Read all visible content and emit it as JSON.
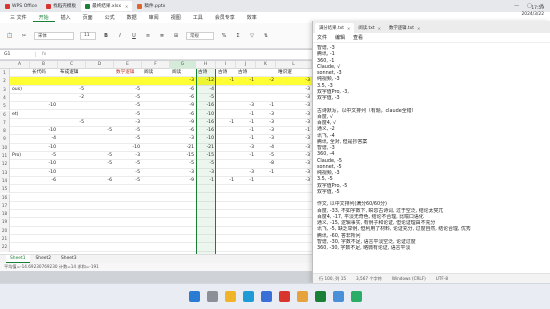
{
  "titlebar": {
    "tabs": [
      {
        "label": "WPS Office",
        "color": "#d9352f",
        "active": false
      },
      {
        "label": "找稻壳模板",
        "color": "#d9352f",
        "active": false
      },
      {
        "label": "最终结果.xlsx",
        "color": "#1a7f37",
        "active": true
      },
      {
        "label": "稿件.pptx",
        "color": "#e0642a",
        "active": false
      }
    ]
  },
  "menubar": {
    "items": [
      "三 文件",
      "开始",
      "插入",
      "页面",
      "公式",
      "数据",
      "审阅",
      "视图",
      "工具",
      "会员专享",
      "效率"
    ],
    "selected": "开始"
  },
  "ribbon": {
    "font_name": "宋体",
    "font_size": "11",
    "number_format": "常规"
  },
  "formula_bar": {
    "cell_ref": "G1",
    "fx": "fx"
  },
  "sheet": {
    "columns": [
      "A",
      "B",
      "C",
      "D",
      "E",
      "F",
      "G",
      "H",
      "I",
      "J",
      "K",
      "L"
    ],
    "selected_column": "G",
    "rows": [
      {
        "n": "1",
        "cells": [
          "",
          "长代码",
          "布成逻辑",
          "",
          "数学逻辑",
          "阅读",
          "阅读",
          "古诗",
          "古诗",
          "古诗",
          "",
          "唯识逻"
        ]
      },
      {
        "n": "2",
        "cells": [
          "",
          "",
          "",
          "",
          "",
          "",
          "-3",
          "-12",
          "-1",
          "-1",
          "-2",
          "-3"
        ]
      },
      {
        "n": "3",
        "cells": [
          "ous)",
          "",
          "-5",
          "",
          "-5",
          "",
          "-6",
          "-4",
          "",
          "",
          "",
          "-3"
        ]
      },
      {
        "n": "4",
        "cells": [
          "",
          "",
          "-2",
          "",
          "-5",
          "",
          "-6",
          "-5",
          "",
          "",
          "",
          "-3"
        ]
      },
      {
        "n": "5",
        "cells": [
          "",
          "-10",
          "",
          "",
          "-5",
          "",
          "-9",
          "-16",
          "",
          "-3",
          "-1",
          "-3"
        ]
      },
      {
        "n": "6",
        "cells": [
          "et)",
          "",
          "",
          "",
          "-5",
          "",
          "-6",
          "-10",
          "",
          "-1",
          "-3",
          "-3"
        ]
      },
      {
        "n": "7",
        "cells": [
          "",
          "",
          "-5",
          "",
          "-3",
          "",
          "-9",
          "-16",
          "-1",
          "-1",
          "-3",
          "-3"
        ]
      },
      {
        "n": "8",
        "cells": [
          "",
          "-10",
          "",
          "-5",
          "-5",
          "",
          "-6",
          "-16",
          "",
          "-1",
          "-3",
          "-1"
        ]
      },
      {
        "n": "9",
        "cells": [
          "",
          "-4",
          "",
          "",
          "-5",
          "",
          "-3",
          "-10",
          "",
          "-1",
          "-3",
          "-3"
        ]
      },
      {
        "n": "10",
        "cells": [
          "",
          "-10",
          "",
          "",
          "-10",
          "",
          "-21",
          "-21",
          "",
          "-3",
          "-4",
          "-3"
        ]
      },
      {
        "n": "11",
        "cells": [
          "Pro)",
          "-5",
          "",
          "-5",
          "-3",
          "",
          "-15",
          "-15",
          "",
          "-1",
          "-5",
          "-3"
        ]
      },
      {
        "n": "12",
        "cells": [
          "",
          "-10",
          "",
          "-5",
          "-5",
          "",
          "-5",
          "-5",
          "",
          "",
          "-8",
          "-3"
        ]
      },
      {
        "n": "13",
        "cells": [
          "",
          "-10",
          "",
          "",
          "-5",
          "",
          "-3",
          "-3",
          "",
          "-3",
          "-1",
          "-3"
        ]
      },
      {
        "n": "14",
        "cells": [
          "",
          "-6",
          "",
          "-6",
          "-5",
          "",
          "-9",
          "-1",
          "-1",
          "-1",
          "",
          "-3"
        ]
      },
      {
        "n": "15",
        "cells": [
          "",
          "",
          "",
          "",
          "",
          "",
          "",
          "",
          "",
          "",
          "",
          ""
        ]
      },
      {
        "n": "16",
        "cells": [
          "",
          "",
          "",
          "",
          "",
          "",
          "",
          "",
          "",
          "",
          "",
          ""
        ]
      },
      {
        "n": "17",
        "cells": [
          "",
          "",
          "",
          "",
          "",
          "",
          "",
          "",
          "",
          "",
          "",
          ""
        ]
      },
      {
        "n": "18",
        "cells": [
          "",
          "",
          "",
          "",
          "",
          "",
          "",
          "",
          "",
          "",
          "",
          ""
        ]
      },
      {
        "n": "19",
        "cells": [
          "",
          "",
          "",
          "",
          "",
          "",
          "",
          "",
          "",
          "",
          "",
          ""
        ]
      },
      {
        "n": "20",
        "cells": [
          "",
          "",
          "",
          "",
          "",
          "",
          "",
          "",
          "",
          "",
          "",
          ""
        ]
      },
      {
        "n": "21",
        "cells": [
          "",
          "",
          "",
          "",
          "",
          "",
          "",
          "",
          "",
          "",
          "",
          ""
        ]
      },
      {
        "n": "22",
        "cells": [
          "",
          "",
          "",
          "",
          "",
          "",
          "",
          "",
          "",
          "",
          "",
          ""
        ]
      }
    ],
    "highlight_row": "2"
  },
  "sheet_tabs": [
    "Sheet1",
    "Sheet2",
    "Sheet3"
  ],
  "active_sheet": "Sheet1",
  "statusbar": "平均值=-14.69230769230 计数=14 求和=-191",
  "notepad": {
    "tabs": [
      {
        "label": "满分结果.txt",
        "active": true
      },
      {
        "label": "阅读.txt",
        "active": false
      },
      {
        "label": "数学逻辑.txt",
        "active": false
      }
    ],
    "menu": [
      "文件",
      "编辑",
      "查看"
    ],
    "lines": [
      "智谱, -3",
      "腾讯, -1",
      "360, -1",
      "Claude, √",
      "sonnet, -3",
      "纯视频, -3",
      "3.5, -3",
      "双字值Pro, -3,",
      "双字值, -3",
      "",
      "古诗默写，以中文排列（有题，claude全错）",
      "百度, √",
      "百度4, √",
      "通义, -2",
      "讯飞, -4",
      "腾讯, 全对, 但是抄答案",
      "智谱, -3",
      "360, -4",
      "Claude, -5",
      "sonnet, -5",
      "纯视频, -3",
      "3.5, -5",
      "双字值Pro, -5",
      "双字值, -5",
      "",
      "作文, 以中文排列(满分60/60分)",
      "百度, -33, 不如字数下, 瞬息古诗词, 过于空泛, 结论太突兀",
      "百度4, -17, 平淡无奇色, 结论不合理, 比喻口语化",
      "通义, -15, 逻辑事实, 有例子和论证, 但论证理由不充分",
      "讯飞, -5, 缺乏举例, 但利用了材料, 论证充分, 过度自然, 结论合理, 优秀",
      "腾讯, -60, 答非所问",
      "智谱, -30, 字数不足, 语言平淡空泛, 论证过度",
      "360, -30, 字数不足, 略微有论证, 语言平淡"
    ],
    "status": [
      "行 100, 列 15",
      "3,567 个字符",
      "Windows (CRLF)",
      "UTF-8"
    ]
  },
  "taskbar": {
    "time": "17:59",
    "date": "2024/3/22",
    "icons": [
      {
        "name": "windows",
        "color": "#2a7bd4"
      },
      {
        "name": "search",
        "color": "#8a8f98"
      },
      {
        "name": "files",
        "color": "#f0b429"
      },
      {
        "name": "edge",
        "color": "#1f9bd6"
      },
      {
        "name": "store",
        "color": "#3a6fd8"
      },
      {
        "name": "wps",
        "color": "#d9352f"
      },
      {
        "name": "chrome",
        "color": "#e6a23c"
      },
      {
        "name": "excel",
        "color": "#1a7f37"
      },
      {
        "name": "notepad",
        "color": "#4a90d9"
      },
      {
        "name": "wechat",
        "color": "#2aae67"
      }
    ]
  }
}
